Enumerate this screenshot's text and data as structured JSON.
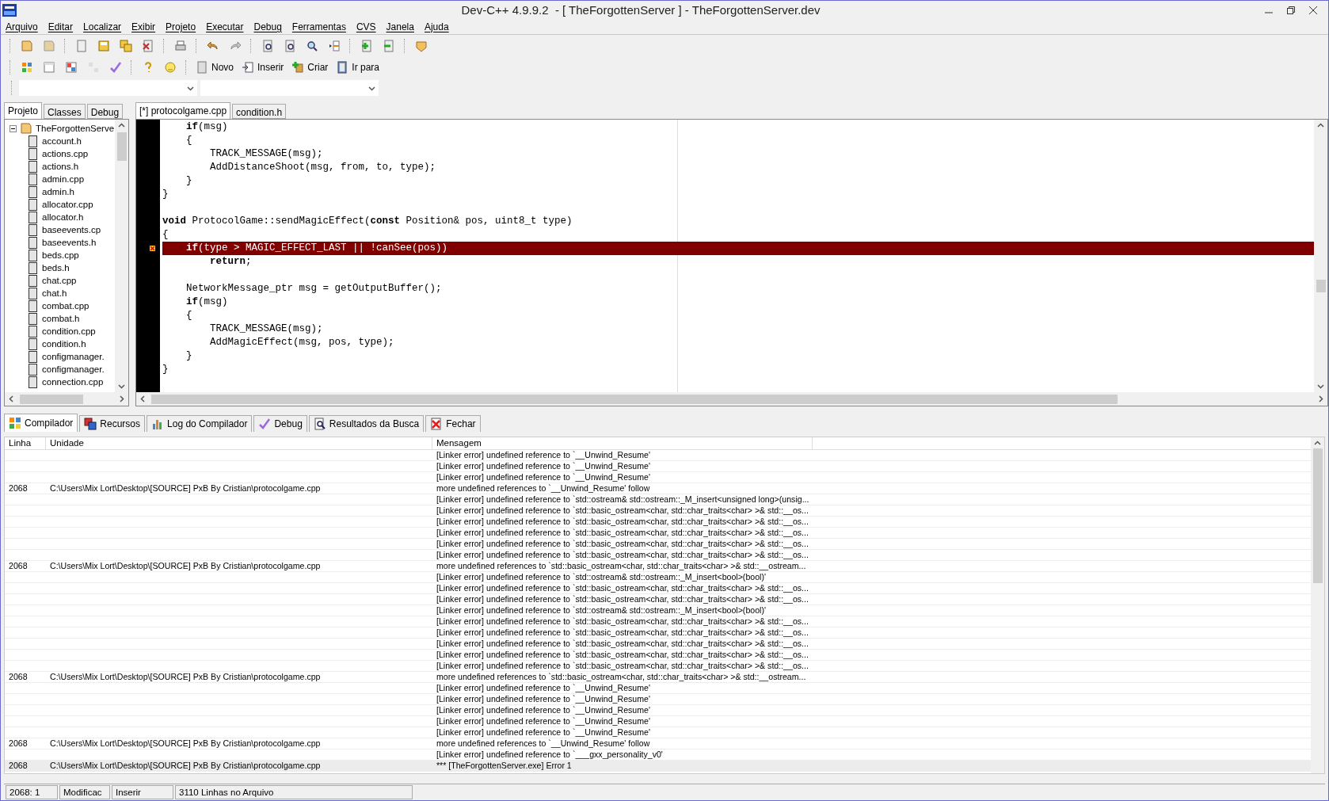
{
  "window": {
    "title": "Dev-C++ 4.9.9.2  - [ TheForgottenServer ] - TheForgottenServer.dev"
  },
  "menu": [
    "Arquivo",
    "Editar",
    "Localizar",
    "Exibir",
    "Projeto",
    "Executar",
    "Debug",
    "Ferramentas",
    "CVS",
    "Janela",
    "Ajuda"
  ],
  "toolbar_buttons": [
    "Novo",
    "Inserir",
    "Criar",
    "Ir para"
  ],
  "sidebar": {
    "tabs": [
      {
        "label": "Projeto",
        "selected": true
      },
      {
        "label": "Classes",
        "selected": false
      },
      {
        "label": "Debug",
        "selected": false
      }
    ],
    "tree": {
      "label": "TheForgottenServe",
      "expanded": true,
      "children": [
        {
          "label": "account.h"
        },
        {
          "label": "actions.cpp"
        },
        {
          "label": "actions.h"
        },
        {
          "label": "admin.cpp"
        },
        {
          "label": "admin.h"
        },
        {
          "label": "allocator.cpp"
        },
        {
          "label": "allocator.h"
        },
        {
          "label": "baseevents.cp"
        },
        {
          "label": "baseevents.h"
        },
        {
          "label": "beds.cpp"
        },
        {
          "label": "beds.h"
        },
        {
          "label": "chat.cpp"
        },
        {
          "label": "chat.h"
        },
        {
          "label": "combat.cpp"
        },
        {
          "label": "combat.h"
        },
        {
          "label": "condition.cpp"
        },
        {
          "label": "condition.h"
        },
        {
          "label": "configmanager."
        },
        {
          "label": "configmanager."
        },
        {
          "label": "connection.cpp"
        }
      ]
    }
  },
  "editor": {
    "tabs": [
      {
        "label": "[*] protocolgame.cpp",
        "selected": true
      },
      {
        "label": "condition.h",
        "selected": false
      }
    ],
    "lines": [
      {
        "code": "    **if**(msg)",
        "error": false
      },
      {
        "code": "    {",
        "error": false
      },
      {
        "code": "        TRACK_MESSAGE(msg);",
        "error": false
      },
      {
        "code": "        AddDistanceShoot(msg, from, to, type);",
        "error": false
      },
      {
        "code": "    }",
        "error": false
      },
      {
        "code": "}",
        "error": false
      },
      {
        "error": false
      },
      {
        "code": "**void** ProtocolGame::sendMagicEffect(**const** Position& pos, uint8_t type)",
        "error": false
      },
      {
        "code": "{",
        "error": false
      },
      {
        "code": "    **if**(type > MAGIC_EFFECT_LAST || !canSee(pos))",
        "error": true
      },
      {
        "code": "        **return**;",
        "error": false
      },
      {
        "error": false
      },
      {
        "code": "    NetworkMessage_ptr msg = getOutputBuffer();",
        "error": false
      },
      {
        "code": "    **if**(msg)",
        "error": false
      },
      {
        "code": "    {",
        "error": false
      },
      {
        "code": "        TRACK_MESSAGE(msg);",
        "error": false
      },
      {
        "code": "        AddMagicEffect(msg, pos, type);",
        "error": false
      },
      {
        "code": "    }",
        "error": false
      },
      {
        "code": "}",
        "error": false
      }
    ]
  },
  "output": {
    "tabs": [
      {
        "label": "Compilador",
        "selected": true
      },
      {
        "label": "Recursos",
        "selected": false
      },
      {
        "label": "Log do Compilador",
        "selected": false
      },
      {
        "label": "Debug",
        "selected": false
      },
      {
        "label": "Resultados da Busca",
        "selected": false
      },
      {
        "label": "Fechar",
        "selected": false
      }
    ],
    "columns": [
      "Linha",
      "Unidade",
      "Mensagem"
    ],
    "rows": [
      {
        "line": "",
        "unit": "",
        "message": "[Linker error] undefined reference to `__Unwind_Resume'",
        "selected": false
      },
      {
        "line": "",
        "unit": "",
        "message": "[Linker error] undefined reference to `__Unwind_Resume'",
        "selected": false
      },
      {
        "line": "",
        "unit": "",
        "message": "[Linker error] undefined reference to `__Unwind_Resume'",
        "selected": false
      },
      {
        "line": "2068",
        "unit": "C:\\Users\\Mix Lort\\Desktop\\[SOURCE] PxB By Cristian\\protocolgame.cpp",
        "message": "more undefined references to `__Unwind_Resume' follow",
        "selected": false
      },
      {
        "line": "",
        "unit": "",
        "message": "[Linker error] undefined reference to `std::ostream& std::ostream::_M_insert<unsigned long>(unsig...",
        "selected": false
      },
      {
        "line": "",
        "unit": "",
        "message": "[Linker error] undefined reference to `std::basic_ostream<char, std::char_traits<char> >& std::__os...",
        "selected": false
      },
      {
        "line": "",
        "unit": "",
        "message": "[Linker error] undefined reference to `std::basic_ostream<char, std::char_traits<char> >& std::__os...",
        "selected": false
      },
      {
        "line": "",
        "unit": "",
        "message": "[Linker error] undefined reference to `std::basic_ostream<char, std::char_traits<char> >& std::__os...",
        "selected": false
      },
      {
        "line": "",
        "unit": "",
        "message": "[Linker error] undefined reference to `std::basic_ostream<char, std::char_traits<char> >& std::__os...",
        "selected": false
      },
      {
        "line": "",
        "unit": "",
        "message": "[Linker error] undefined reference to `std::basic_ostream<char, std::char_traits<char> >& std::__os...",
        "selected": false
      },
      {
        "line": "2068",
        "unit": "C:\\Users\\Mix Lort\\Desktop\\[SOURCE] PxB By Cristian\\protocolgame.cpp",
        "message": "more undefined references to `std::basic_ostream<char, std::char_traits<char> >& std::__ostream...",
        "selected": false
      },
      {
        "line": "",
        "unit": "",
        "message": "[Linker error] undefined reference to `std::ostream& std::ostream::_M_insert<bool>(bool)'",
        "selected": false
      },
      {
        "line": "",
        "unit": "",
        "message": "[Linker error] undefined reference to `std::basic_ostream<char, std::char_traits<char> >& std::__os...",
        "selected": false
      },
      {
        "line": "",
        "unit": "",
        "message": "[Linker error] undefined reference to `std::basic_ostream<char, std::char_traits<char> >& std::__os...",
        "selected": false
      },
      {
        "line": "",
        "unit": "",
        "message": "[Linker error] undefined reference to `std::ostream& std::ostream::_M_insert<bool>(bool)'",
        "selected": false
      },
      {
        "line": "",
        "unit": "",
        "message": "[Linker error] undefined reference to `std::basic_ostream<char, std::char_traits<char> >& std::__os...",
        "selected": false
      },
      {
        "line": "",
        "unit": "",
        "message": "[Linker error] undefined reference to `std::basic_ostream<char, std::char_traits<char> >& std::__os...",
        "selected": false
      },
      {
        "line": "",
        "unit": "",
        "message": "[Linker error] undefined reference to `std::basic_ostream<char, std::char_traits<char> >& std::__os...",
        "selected": false
      },
      {
        "line": "",
        "unit": "",
        "message": "[Linker error] undefined reference to `std::basic_ostream<char, std::char_traits<char> >& std::__os...",
        "selected": false
      },
      {
        "line": "",
        "unit": "",
        "message": "[Linker error] undefined reference to `std::basic_ostream<char, std::char_traits<char> >& std::__os...",
        "selected": false
      },
      {
        "line": "2068",
        "unit": "C:\\Users\\Mix Lort\\Desktop\\[SOURCE] PxB By Cristian\\protocolgame.cpp",
        "message": "more undefined references to `std::basic_ostream<char, std::char_traits<char> >& std::__ostream...",
        "selected": false
      },
      {
        "line": "",
        "unit": "",
        "message": "[Linker error] undefined reference to `__Unwind_Resume'",
        "selected": false
      },
      {
        "line": "",
        "unit": "",
        "message": "[Linker error] undefined reference to `__Unwind_Resume'",
        "selected": false
      },
      {
        "line": "",
        "unit": "",
        "message": "[Linker error] undefined reference to `__Unwind_Resume'",
        "selected": false
      },
      {
        "line": "",
        "unit": "",
        "message": "[Linker error] undefined reference to `__Unwind_Resume'",
        "selected": false
      },
      {
        "line": "",
        "unit": "",
        "message": "[Linker error] undefined reference to `__Unwind_Resume'",
        "selected": false
      },
      {
        "line": "2068",
        "unit": "C:\\Users\\Mix Lort\\Desktop\\[SOURCE] PxB By Cristian\\protocolgame.cpp",
        "message": "more undefined references to `__Unwind_Resume' follow",
        "selected": false
      },
      {
        "line": "",
        "unit": "",
        "message": "[Linker error] undefined reference to `___gxx_personality_v0'",
        "selected": false
      },
      {
        "line": "2068",
        "unit": "C:\\Users\\Mix Lort\\Desktop\\[SOURCE] PxB By Cristian\\protocolgame.cpp",
        "message": "*** [TheForgottenServer.exe] Error 1",
        "selected": true
      }
    ]
  },
  "status_bar": [
    "2068: 1",
    "Modificac",
    "Inserir",
    "3110 Linhas no Arquivo"
  ]
}
